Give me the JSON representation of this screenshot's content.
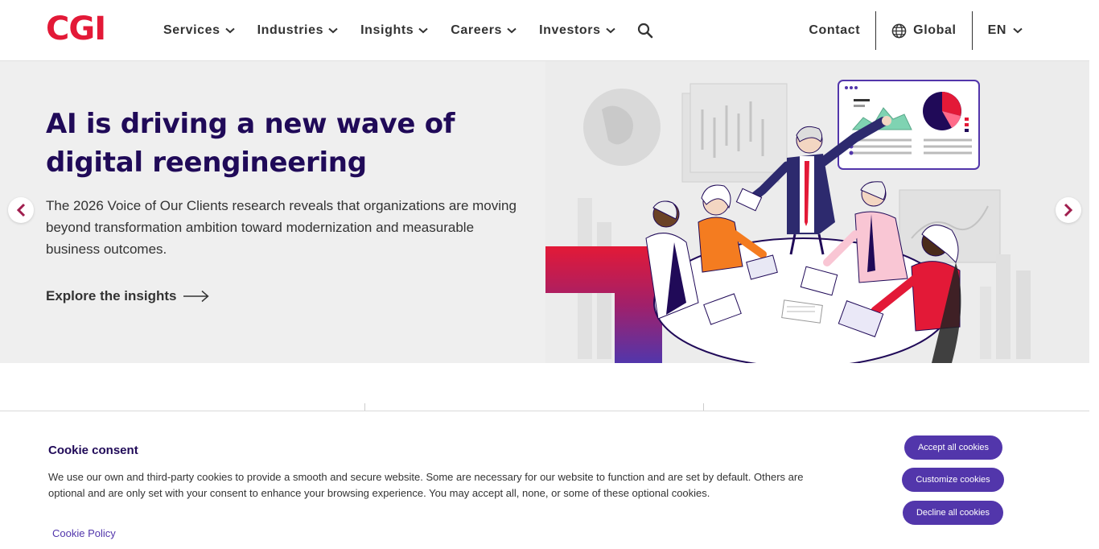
{
  "brand": {
    "logo_text": "CGI",
    "logo_color": "#e31937",
    "primary": "#5236ab",
    "heading": "#200a58"
  },
  "nav": {
    "items": [
      {
        "label": "Services"
      },
      {
        "label": "Industries"
      },
      {
        "label": "Insights"
      },
      {
        "label": "Careers"
      },
      {
        "label": "Investors"
      }
    ],
    "search_icon": "search-icon",
    "contact": "Contact",
    "region": "Global",
    "language": "EN"
  },
  "hero": {
    "title": "AI is driving a new wave of digital reengineering",
    "description": "The 2026 Voice of Our Clients research reveals that organizations are moving beyond transformation ambition toward modernization and measurable business outcomes.",
    "link": "Explore the insights"
  },
  "cookie": {
    "title": "Cookie consent",
    "text": "We use our own and third-party cookies to provide a smooth and secure website. Some are necessary for our website to function and are set by default. Others are optional and are only set with your consent to enhance your browsing experience. You may accept all, none, or some of these optional cookies.",
    "policy_link": "Cookie Policy",
    "accept": "Accept all cookies",
    "customize": "Customize cookies",
    "decline": "Decline all cookies"
  }
}
